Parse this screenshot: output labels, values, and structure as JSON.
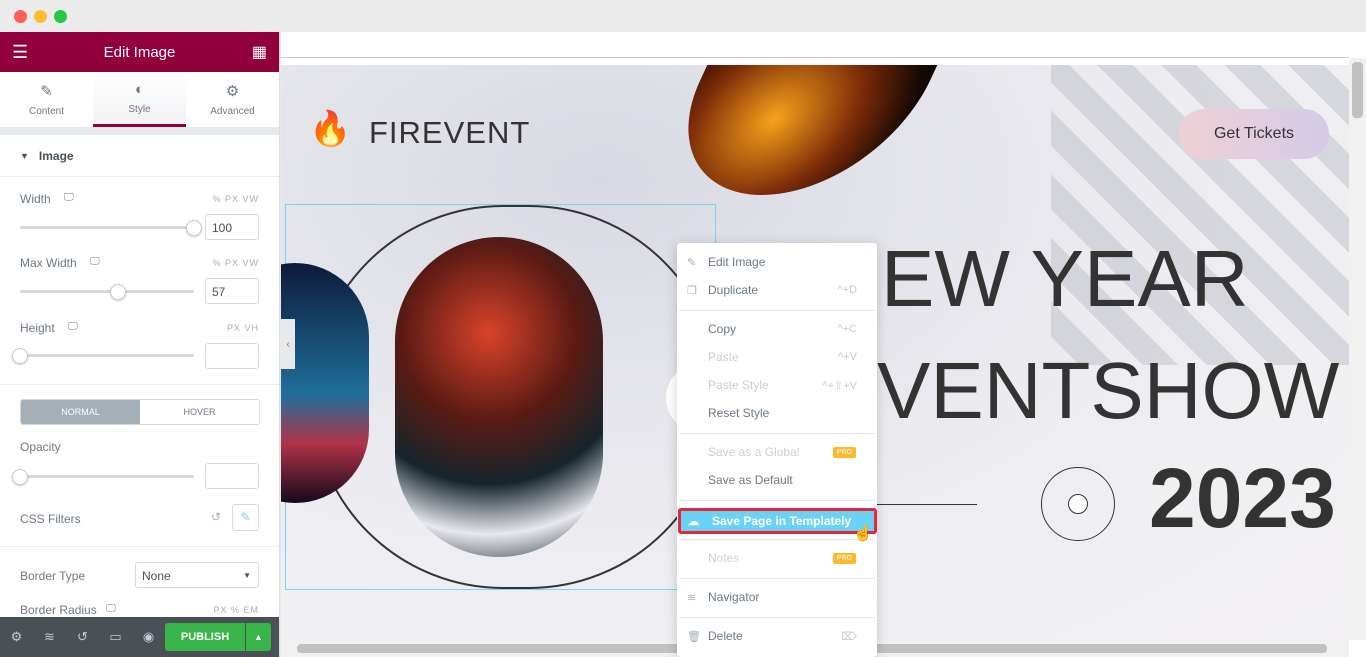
{
  "window": {
    "controls": [
      "close",
      "minimize",
      "maximize"
    ],
    "colors": [
      "#fe5f57",
      "#febc2e",
      "#28c840"
    ]
  },
  "panel": {
    "title": "Edit Image",
    "menu_icon": "hamburger-icon",
    "apps_icon": "grid-icon",
    "tabs": [
      {
        "label": "Content",
        "icon": "pencil-icon"
      },
      {
        "label": "Style",
        "icon": "contrast-icon",
        "active": true
      },
      {
        "label": "Advanced",
        "icon": "gear-icon"
      }
    ],
    "section": "Image",
    "width": {
      "label": "Width",
      "units": "% PX VW",
      "value": "100",
      "slider": 100
    },
    "max_width": {
      "label": "Max Width",
      "units": "% PX VW",
      "value": "57",
      "slider": 57
    },
    "height": {
      "label": "Height",
      "units": "PX VH",
      "value": "",
      "slider": 0
    },
    "state_tabs": [
      "NORMAL",
      "HOVER"
    ],
    "opacity": {
      "label": "Opacity",
      "value": "",
      "slider": 0
    },
    "css_filters": "CSS Filters",
    "border_type": {
      "label": "Border Type",
      "value": "None"
    },
    "border_radius": {
      "label": "Border Radius",
      "units": "PX % EM"
    },
    "publish": "PUBLISH"
  },
  "site": {
    "logo": "FIREVENT",
    "cta": "Get Tickets",
    "headline1": "EW YEAR",
    "headline2": "VENTSHOW",
    "year": "2023"
  },
  "context_menu": [
    {
      "label": "Edit Image",
      "icon": "pencil-icon",
      "shortcut": ""
    },
    {
      "label": "Duplicate",
      "icon": "copy-icon",
      "shortcut": "^+D"
    },
    {
      "label": "Copy",
      "shortcut": "^+C"
    },
    {
      "label": "Paste",
      "shortcut": "^+V",
      "disabled": true
    },
    {
      "label": "Paste Style",
      "shortcut": "^+⇧+V",
      "disabled": true
    },
    {
      "label": "Reset Style",
      "shortcut": ""
    },
    {
      "label": "Save as a Global",
      "badge": "PRO",
      "disabled": true
    },
    {
      "label": "Save as Default"
    },
    {
      "label": "Save Page in Templately",
      "icon": "cloud-icon",
      "highlighted": true
    },
    {
      "label": "Notes",
      "badge": "PRO",
      "disabled": true
    },
    {
      "label": "Navigator",
      "icon": "layers-icon"
    },
    {
      "label": "Delete",
      "icon": "trash-icon",
      "shortcut": "⌦"
    }
  ],
  "accent": "#92003b",
  "highlight": "#61ce70"
}
